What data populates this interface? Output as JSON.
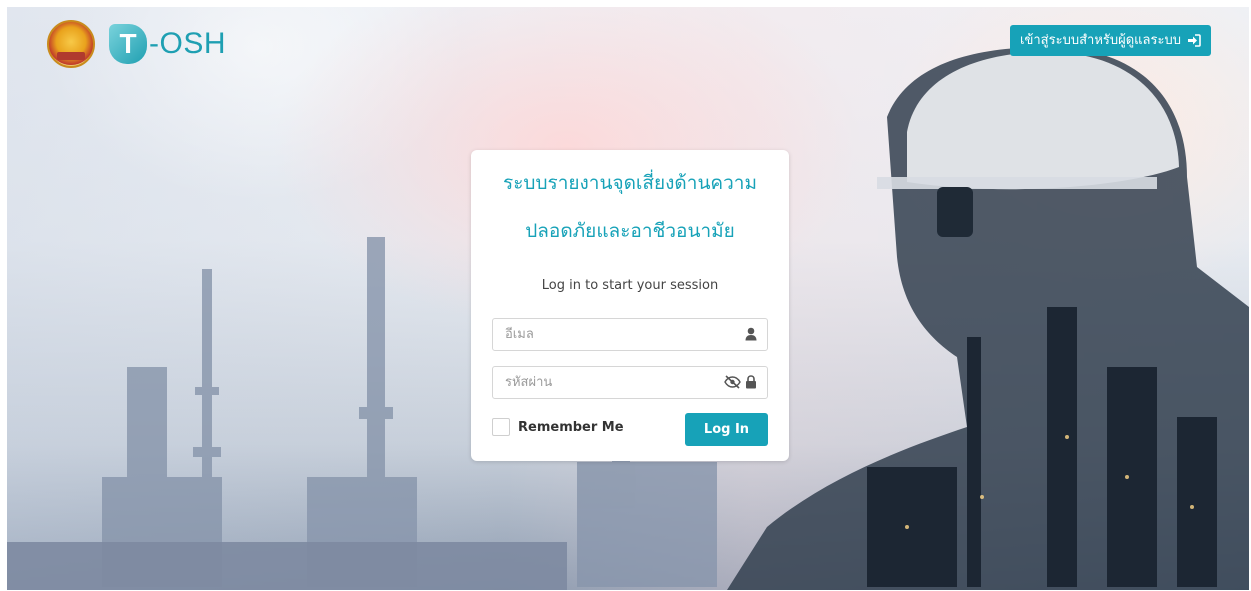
{
  "header": {
    "seal_icon": "government-seal-logo",
    "logo_text": "-OSH",
    "logo_mark": "T",
    "admin_button_label": "เข้าสู่ระบบสำหรับผู้ดูแลระบบ",
    "admin_button_icon": "sign-in-icon"
  },
  "login": {
    "title_line1": "ระบบรายงานจุดเสี่ยงด้านความ",
    "title_line2": "ปลอดภัยและอาชีวอนามัย",
    "subtitle": "Log in to start your session",
    "email_placeholder": "อีเมล",
    "email_value": "",
    "email_icon": "user-icon",
    "password_placeholder": "รหัสผ่าน",
    "password_value": "",
    "password_icons": [
      "eye-slash-icon",
      "lock-icon"
    ],
    "remember_label": "Remember Me",
    "remember_checked": false,
    "login_button_label": "Log In"
  },
  "colors": {
    "accent": "#17a2b8",
    "logo_teal": "#1e9fb2"
  }
}
